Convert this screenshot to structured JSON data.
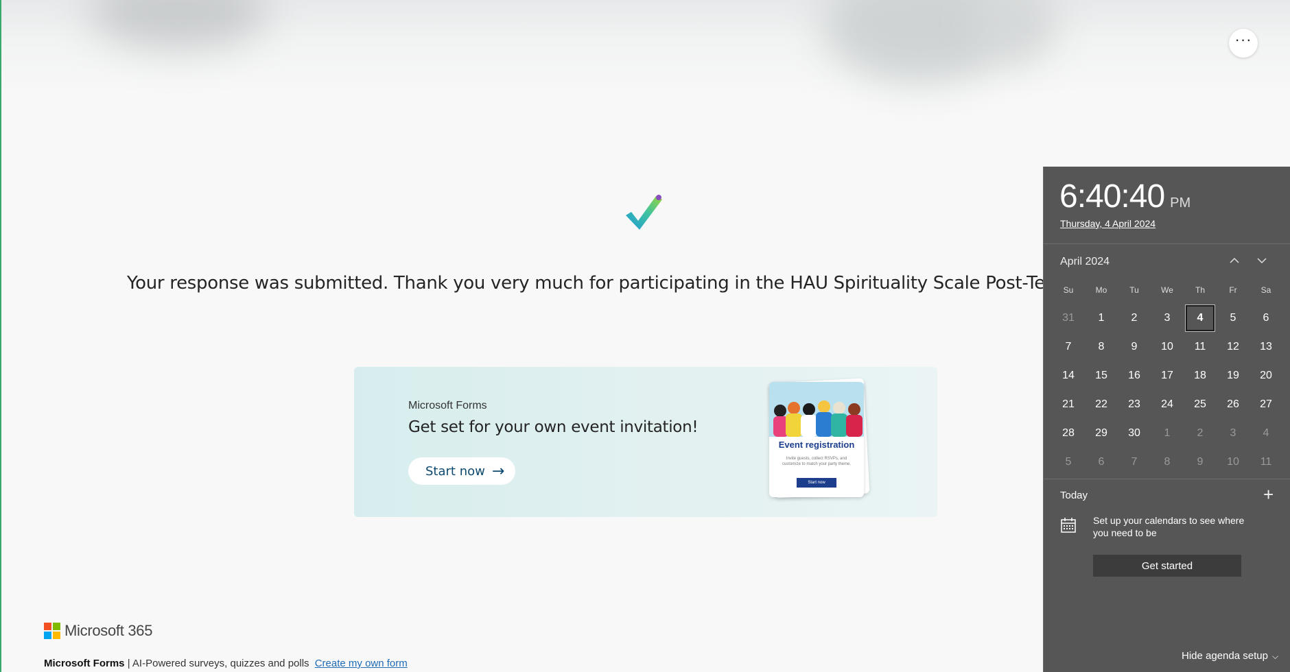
{
  "header": {
    "more_icon": "ellipsis-icon",
    "more_label": "···"
  },
  "confirmation": {
    "icon": "checkmark-icon",
    "message": "Your response was submitted. Thank you very much for participating in the HAU Spirituality Scale Post-Test survey. Lau"
  },
  "promo": {
    "kicker": "Microsoft Forms",
    "title": "Get set for your own event invitation!",
    "button_label": "Start now",
    "button_icon": "arrow-right-icon",
    "card_title": "Event registration",
    "card_body": "Invite guests, collect RSVPs, and customize to match your party theme.",
    "card_button": "Start now"
  },
  "footer": {
    "brand": "Microsoft 365",
    "product": "Microsoft Forms",
    "tagline": "| AI-Powered surveys, quizzes and polls",
    "link": "Create my own form",
    "logo_colors": [
      "#f25022",
      "#7fba00",
      "#00a4ef",
      "#ffb900"
    ]
  },
  "calendar": {
    "time": "6:40:40",
    "ampm": "PM",
    "date": "Thursday, 4 April 2024",
    "month_label": "April 2024",
    "up_icon": "chevron-up-icon",
    "down_icon": "chevron-down-icon",
    "weekdays": [
      "Su",
      "Mo",
      "Tu",
      "We",
      "Th",
      "Fr",
      "Sa"
    ],
    "weeks": [
      [
        {
          "d": "31",
          "m": true
        },
        {
          "d": "1"
        },
        {
          "d": "2"
        },
        {
          "d": "3"
        },
        {
          "d": "4",
          "today": true
        },
        {
          "d": "5"
        },
        {
          "d": "6"
        }
      ],
      [
        {
          "d": "7"
        },
        {
          "d": "8"
        },
        {
          "d": "9"
        },
        {
          "d": "10"
        },
        {
          "d": "11"
        },
        {
          "d": "12"
        },
        {
          "d": "13"
        }
      ],
      [
        {
          "d": "14"
        },
        {
          "d": "15"
        },
        {
          "d": "16"
        },
        {
          "d": "17"
        },
        {
          "d": "18"
        },
        {
          "d": "19"
        },
        {
          "d": "20"
        }
      ],
      [
        {
          "d": "21"
        },
        {
          "d": "22"
        },
        {
          "d": "23"
        },
        {
          "d": "24"
        },
        {
          "d": "25"
        },
        {
          "d": "26"
        },
        {
          "d": "27"
        }
      ],
      [
        {
          "d": "28"
        },
        {
          "d": "29"
        },
        {
          "d": "30"
        },
        {
          "d": "1",
          "m": true
        },
        {
          "d": "2",
          "m": true
        },
        {
          "d": "3",
          "m": true
        },
        {
          "d": "4",
          "m": true
        }
      ],
      [
        {
          "d": "5",
          "m": true
        },
        {
          "d": "6",
          "m": true
        },
        {
          "d": "7",
          "m": true
        },
        {
          "d": "8",
          "m": true
        },
        {
          "d": "9",
          "m": true
        },
        {
          "d": "10",
          "m": true
        },
        {
          "d": "11",
          "m": true
        }
      ]
    ],
    "today_label": "Today",
    "add_icon": "plus-icon",
    "agenda_icon": "calendar-icon",
    "agenda_text": "Set up your calendars to see where you need to be",
    "get_started": "Get started",
    "hide_agenda": "Hide agenda setup"
  }
}
